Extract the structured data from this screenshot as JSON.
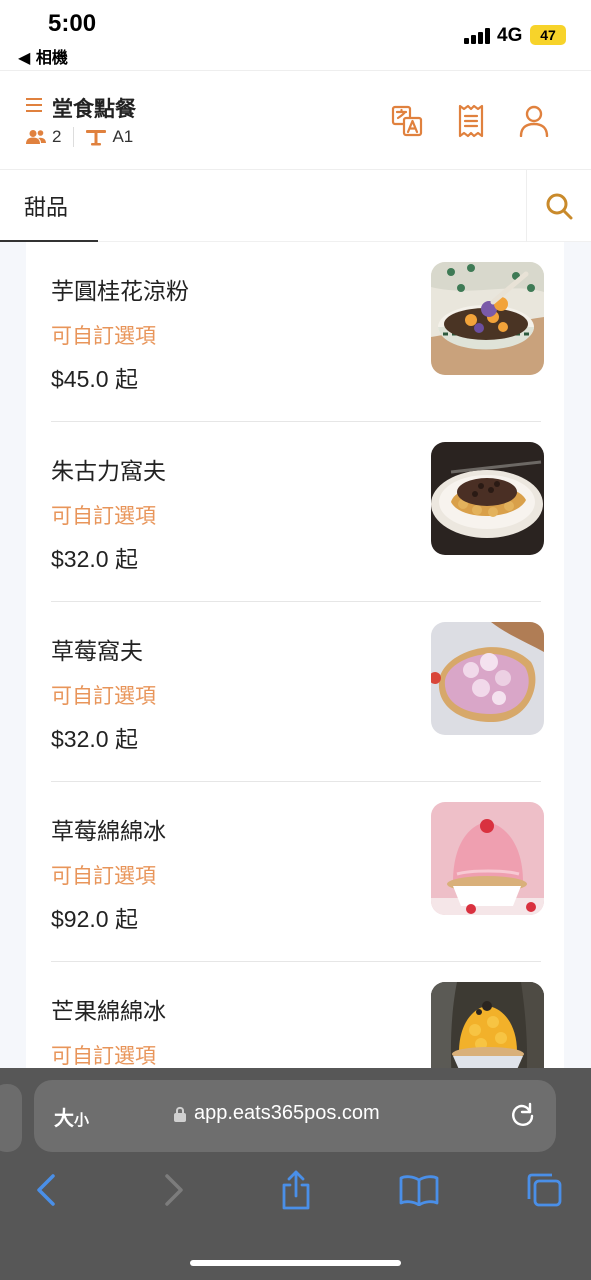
{
  "status_bar": {
    "time": "5:00",
    "back_app": "◀ 相機",
    "network": "4G",
    "battery": "47"
  },
  "header": {
    "title": "堂食點餐",
    "guests": "2",
    "table": "A1"
  },
  "category": {
    "active_tab": "甜品"
  },
  "items": [
    {
      "name": "芋圓桂花涼粉",
      "option_label": "可自訂選項",
      "price": "$45.0",
      "price_suffix": "起"
    },
    {
      "name": "朱古力窩夫",
      "option_label": "可自訂選項",
      "price": "$32.0",
      "price_suffix": "起"
    },
    {
      "name": "草莓窩夫",
      "option_label": "可自訂選項",
      "price": "$32.0",
      "price_suffix": "起"
    },
    {
      "name": "草莓綿綿冰",
      "option_label": "可自訂選項",
      "price": "$92.0",
      "price_suffix": "起"
    },
    {
      "name": "芒果綿綿冰",
      "option_label": "可自訂選項",
      "price": "",
      "price_suffix": ""
    }
  ],
  "browser": {
    "text_size_big": "大",
    "text_size_small": "小",
    "url": "app.eats365pos.com"
  },
  "colors": {
    "accent": "#e0813e",
    "option_text": "#e8955a",
    "search_icon": "#c98a2b",
    "browser_icon": "#4a8fe8"
  }
}
